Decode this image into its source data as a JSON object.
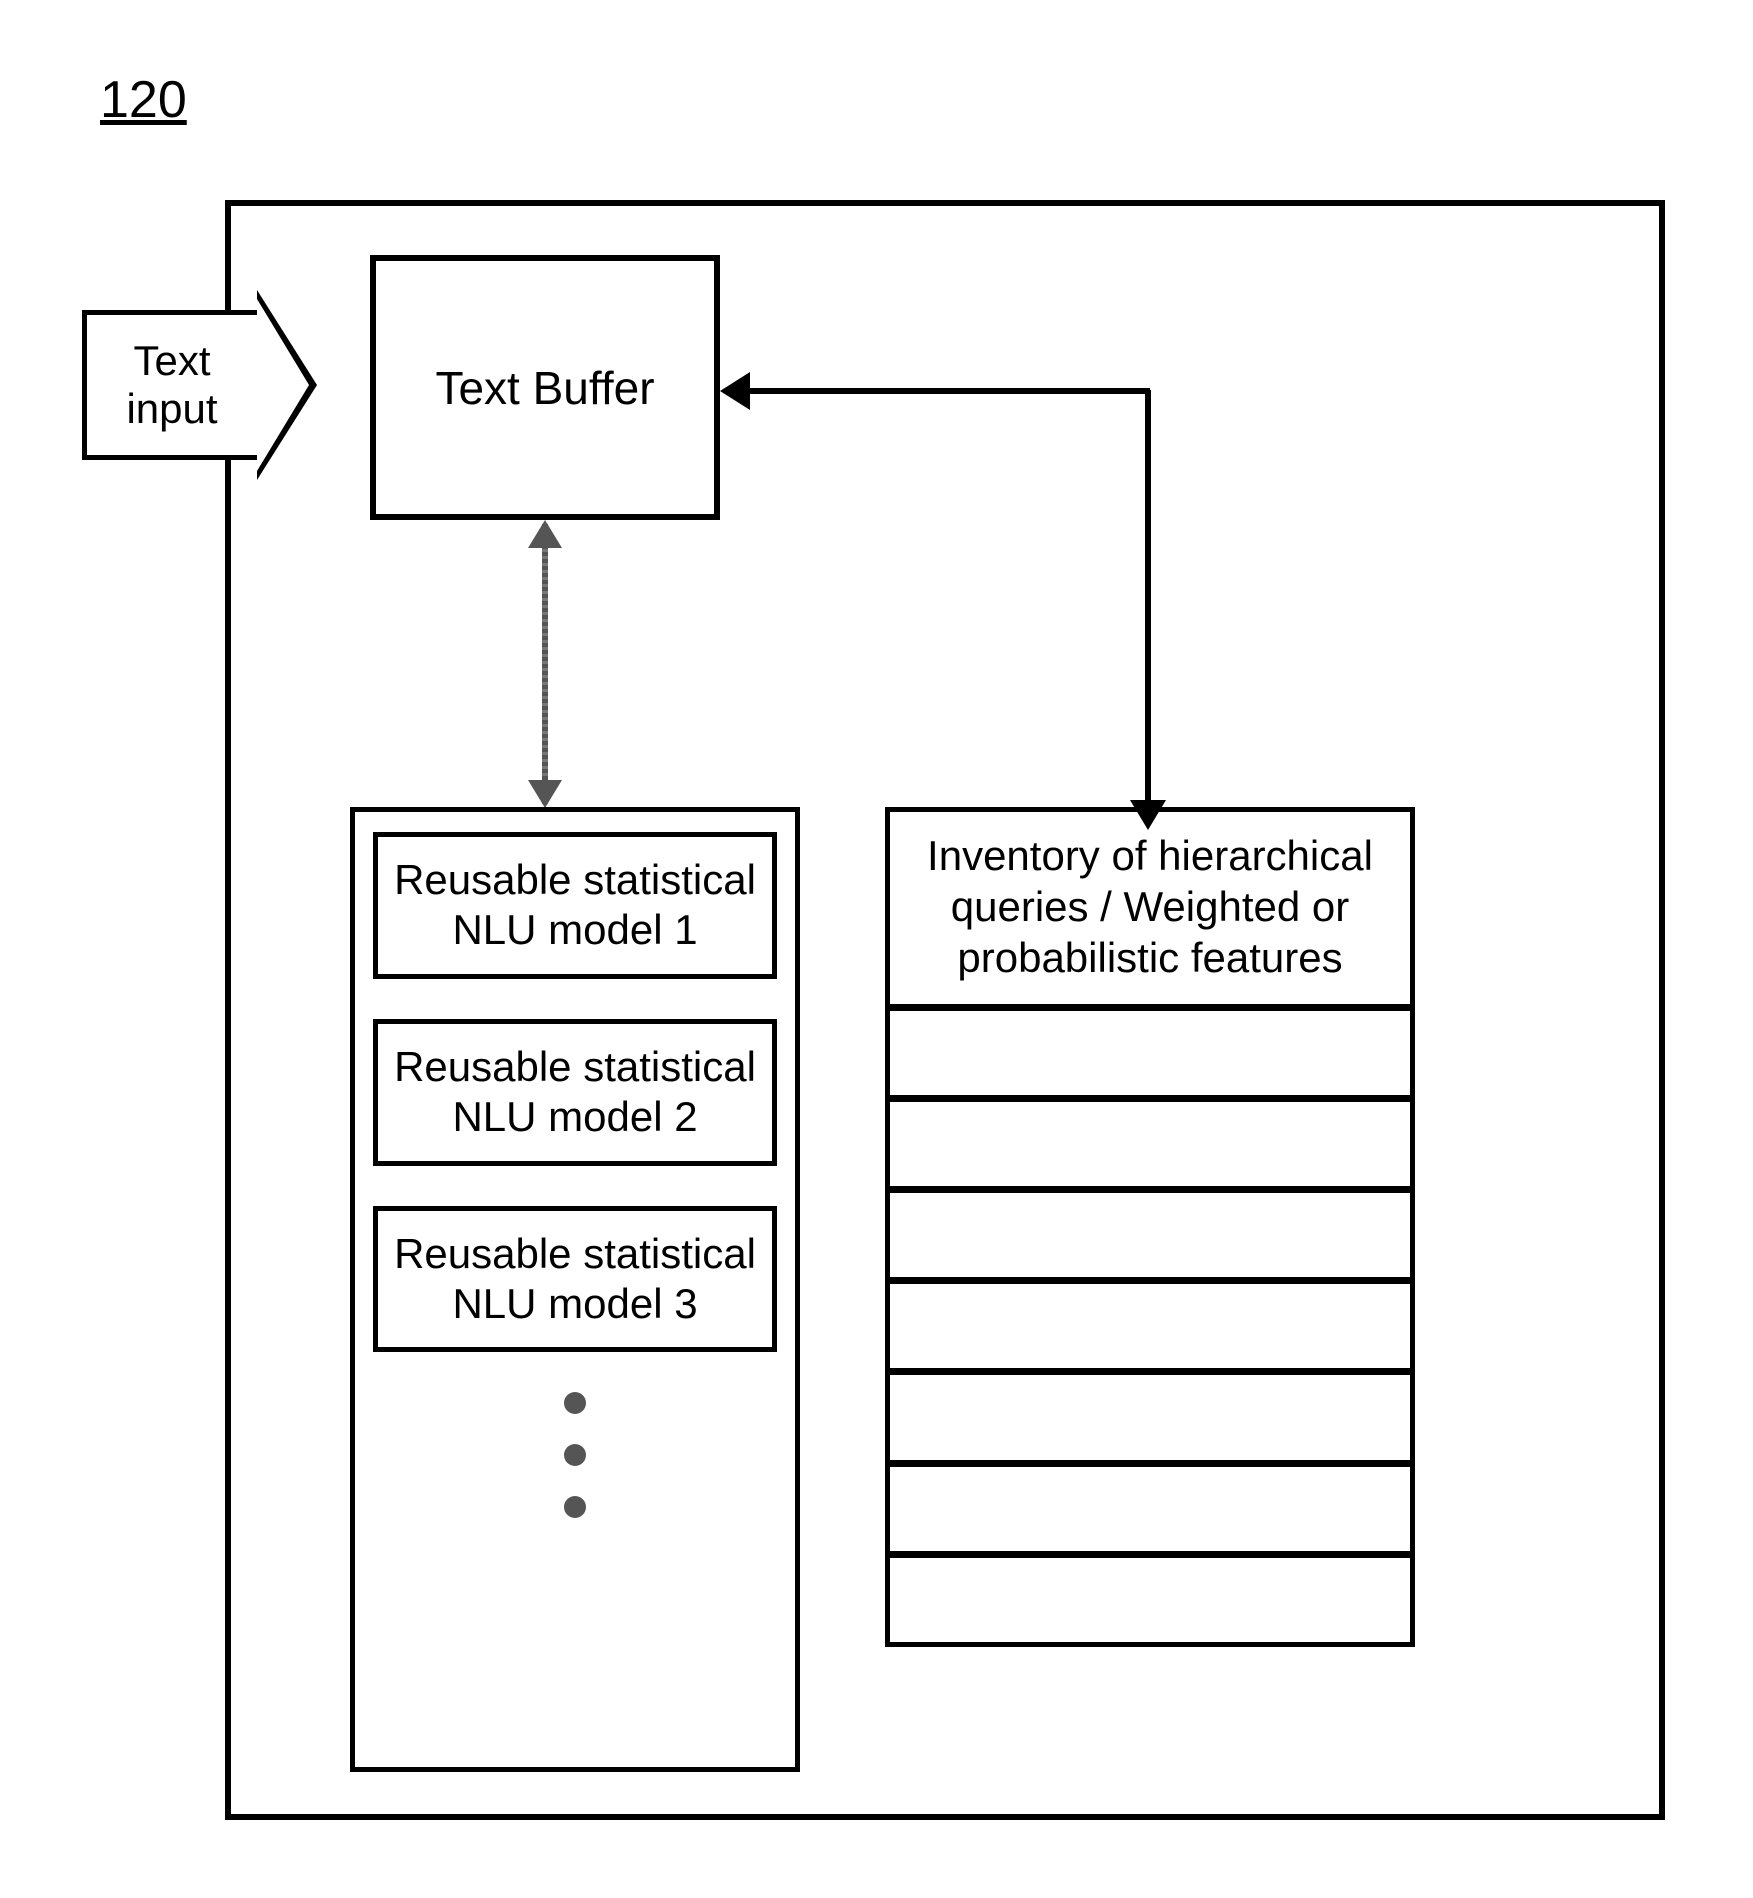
{
  "figure_number": "120",
  "input_label": "Text input",
  "text_buffer_label": "Text Buffer",
  "models": [
    "Reusable statistical NLU model 1",
    "Reusable statistical NLU model 2",
    "Reusable statistical NLU model 3"
  ],
  "inventory_label": "Inventory of hierarchical queries / Weighted or probabilistic features",
  "inventory_row_count": 7
}
